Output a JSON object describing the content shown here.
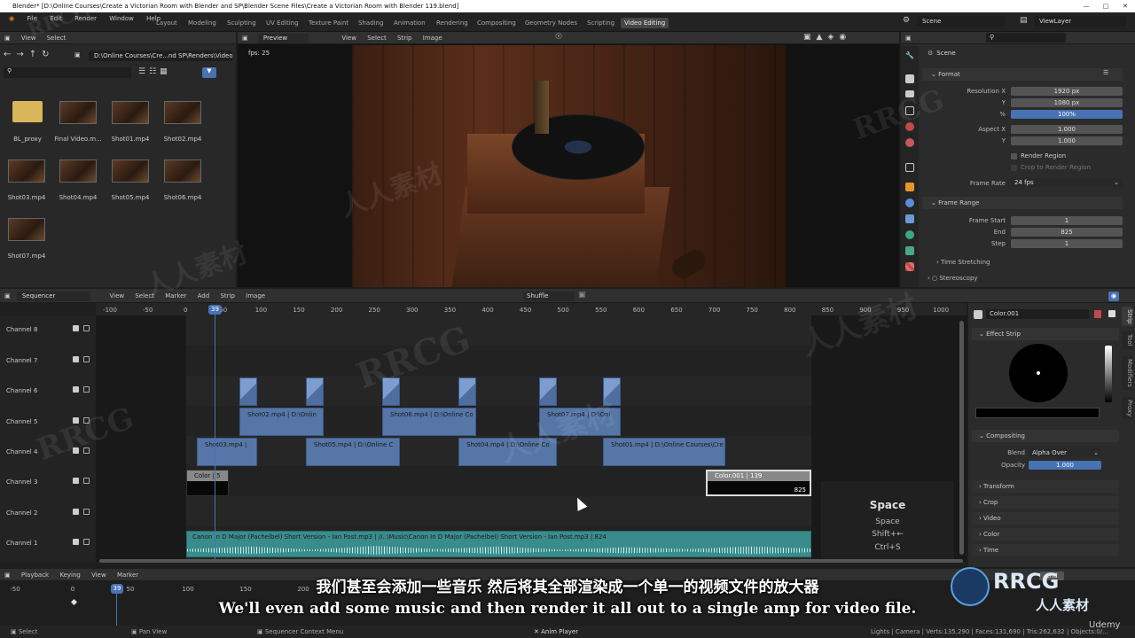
{
  "window": {
    "title": "Blender* [D:\\Online Courses\\Create a Victorian Room with Blender and SP\\Blender Scene Files\\Create a Victorian Room with Blender 119.blend]"
  },
  "menu": [
    "File",
    "Edit",
    "Render",
    "Window",
    "Help"
  ],
  "workspaces": [
    {
      "label": "Layout",
      "active": false
    },
    {
      "label": "Modeling",
      "active": false
    },
    {
      "label": "Sculpting",
      "active": false
    },
    {
      "label": "UV Editing",
      "active": false
    },
    {
      "label": "Texture Paint",
      "active": false
    },
    {
      "label": "Shading",
      "active": false
    },
    {
      "label": "Animation",
      "active": false
    },
    {
      "label": "Rendering",
      "active": false
    },
    {
      "label": "Compositing",
      "active": false
    },
    {
      "label": "Geometry Nodes",
      "active": false
    },
    {
      "label": "Scripting",
      "active": false
    },
    {
      "label": "Video Editing",
      "active": true
    }
  ],
  "scene_selector": {
    "scene": "Scene",
    "view_layer": "ViewLayer"
  },
  "file_browser": {
    "menu": [
      "View",
      "Select"
    ],
    "path": "D:\\Online Courses\\Cre...nd SP\\Renders\\Videos\\",
    "files": [
      {
        "name": "BL_proxy",
        "type": "folder"
      },
      {
        "name": "Final Video.m...",
        "type": "video"
      },
      {
        "name": "Shot01.mp4",
        "type": "video"
      },
      {
        "name": "Shot02.mp4",
        "type": "video"
      },
      {
        "name": "Shot03.mp4",
        "type": "video"
      },
      {
        "name": "Shot04.mp4",
        "type": "video"
      },
      {
        "name": "Shot05.mp4",
        "type": "video"
      },
      {
        "name": "Shot06.mp4",
        "type": "video"
      },
      {
        "name": "Shot07.mp4",
        "type": "video"
      }
    ]
  },
  "preview": {
    "mode": "Preview",
    "menu": [
      "View",
      "Select",
      "Strip",
      "Image"
    ],
    "fps_text": "fps: 25"
  },
  "properties": {
    "scene_label": "Scene",
    "format": {
      "title": "Format",
      "resolution_x_label": "Resolution X",
      "resolution_x": "1920 px",
      "y_label": "Y",
      "resolution_y": "1080 px",
      "pct_label": "%",
      "resolution_pct": "100%",
      "aspect_x_label": "Aspect X",
      "aspect_x": "1.000",
      "aspect_y_label": "Y",
      "aspect_y": "1.000",
      "render_region": "Render Region",
      "crop_region": "Crop to Render Region",
      "frame_rate_label": "Frame Rate",
      "frame_rate": "24 fps"
    },
    "frame_range": {
      "title": "Frame Range",
      "start_label": "Frame Start",
      "start": "1",
      "end_label": "End",
      "end": "825",
      "step_label": "Step",
      "step": "1",
      "time_stretching": "Time Stretching",
      "stereoscopy": "Stereoscopy"
    }
  },
  "sequencer": {
    "editor": "Sequencer",
    "menu": [
      "View",
      "Select",
      "Marker",
      "Add",
      "Strip",
      "Image"
    ],
    "overlap_mode": "Shuffle",
    "ruler": [
      "-100",
      "-50",
      "0",
      "50",
      "100",
      "150",
      "200",
      "250",
      "300",
      "350",
      "400",
      "450",
      "500",
      "550",
      "600",
      "650",
      "700",
      "750",
      "800",
      "850",
      "900",
      "950",
      "1000"
    ],
    "current_frame": "39",
    "channels": [
      "Channel 8",
      "Channel 7",
      "Channel 6",
      "Channel 5",
      "Channel 4",
      "Channel 3",
      "Channel 2",
      "Channel 1"
    ],
    "strips": {
      "shot02": "Shot02.mp4 | D:\\Onlin",
      "shot06": "Shot06.mp4 | D:\\Online Co",
      "shot07": "Shot07.mp4 | D:\\Onl",
      "shot03": "Shot03.mp4 |",
      "shot05": "Shot05.mp4 | D:\\Online C",
      "shot04": "Shot04.mp4 | D:\\Online Co",
      "shot01": "Shot01.mp4 | D:\\Online Courses\\Cre",
      "color_a": "Color | 5",
      "color_b": "Color.001 | 139",
      "color_b_end": "825",
      "audio": "Canon In D Major (Pachelbel)   Short Version - Ian Post.mp3 | //..\\Music\\Canon In D Major (Pachelbel)   Short Version - Ian Post.mp3 | 824"
    },
    "key_overlay": {
      "title": "Space",
      "lines": [
        "Space",
        "Shift+←",
        "Ctrl+S"
      ]
    }
  },
  "strip_props": {
    "name": "Color.001",
    "effect_strip": "Effect Strip",
    "compositing": "Compositing",
    "blend_label": "Blend",
    "blend": "Alpha Over",
    "opacity_label": "Opacity",
    "opacity": "1.000",
    "sections": [
      "Transform",
      "Crop",
      "Video",
      "Color",
      "Time"
    ],
    "tabs": [
      "Strip",
      "Tool",
      "Modifiers",
      "Proxy"
    ]
  },
  "timeline": {
    "menu": [
      "Playback",
      "Keying",
      "View",
      "Marker"
    ],
    "ruler": [
      "-50",
      "0",
      "50",
      "100",
      "150",
      "200",
      "250"
    ],
    "current_frame": "39",
    "end_frame": "End"
  },
  "statusbar": {
    "items": [
      "Select",
      "Pan View",
      "Sequencer Context Menu",
      "Anim Player"
    ],
    "stats": "Lights | Camera | Verts:135,290 | Faces:131,690 | Tris:262,632 | Objects:0/..."
  },
  "subtitles": {
    "zh": "我们甚至会添加一些音乐 然后将其全部渲染成一个单一的视频文件的放大器",
    "en": "We'll even add some music and then render it all out to a single amp for video file."
  },
  "watermarks": {
    "brand": "RRCG",
    "cn": "人人素材",
    "udemy": "Udemy"
  },
  "colors": {
    "accent": "#4772b3",
    "strip": "#5576a6",
    "audio": "#3a8c8c"
  }
}
